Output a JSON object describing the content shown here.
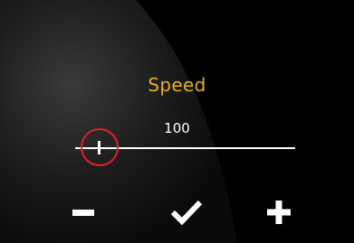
{
  "screen": {
    "title": "Speed",
    "value": "100",
    "slider_level": 0.11,
    "colors": {
      "title": "#e8b023",
      "highlight": "#e3202b",
      "foreground": "#ffffff",
      "background": "#000000"
    }
  },
  "controls": {
    "decrease_icon": "minus-icon",
    "confirm_icon": "checkmark-icon",
    "increase_icon": "plus-icon"
  }
}
